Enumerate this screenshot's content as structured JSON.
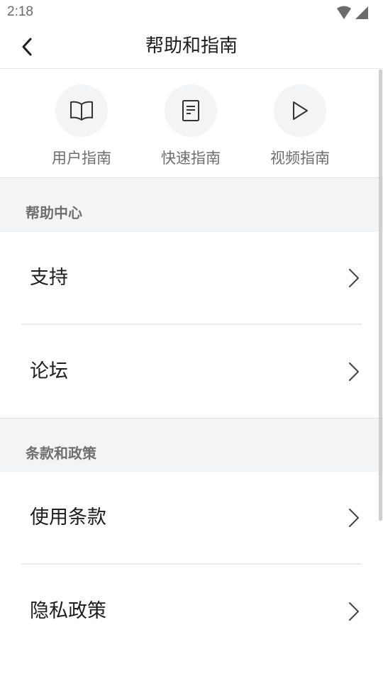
{
  "status_bar": {
    "time": "2:18",
    "icons": [
      "wifi-icon",
      "cellular-signal-icon"
    ]
  },
  "header": {
    "title": "帮助和指南",
    "back_icon": "chevron-left-icon"
  },
  "quick_guides": [
    {
      "label": "用户指南",
      "icon": "open-book-icon"
    },
    {
      "label": "快速指南",
      "icon": "document-icon"
    },
    {
      "label": "视频指南",
      "icon": "play-icon"
    }
  ],
  "sections": [
    {
      "title": "帮助中心",
      "items": [
        {
          "label": "支持"
        },
        {
          "label": "论坛"
        }
      ]
    },
    {
      "title": "条款和政策",
      "items": [
        {
          "label": "使用条款"
        },
        {
          "label": "隐私政策"
        }
      ]
    }
  ],
  "colors": {
    "section_bg": "#f3f4f6",
    "primary_text": "#1e1e1e",
    "secondary_text": "#6f6f6f",
    "divider": "#ebebeb"
  }
}
